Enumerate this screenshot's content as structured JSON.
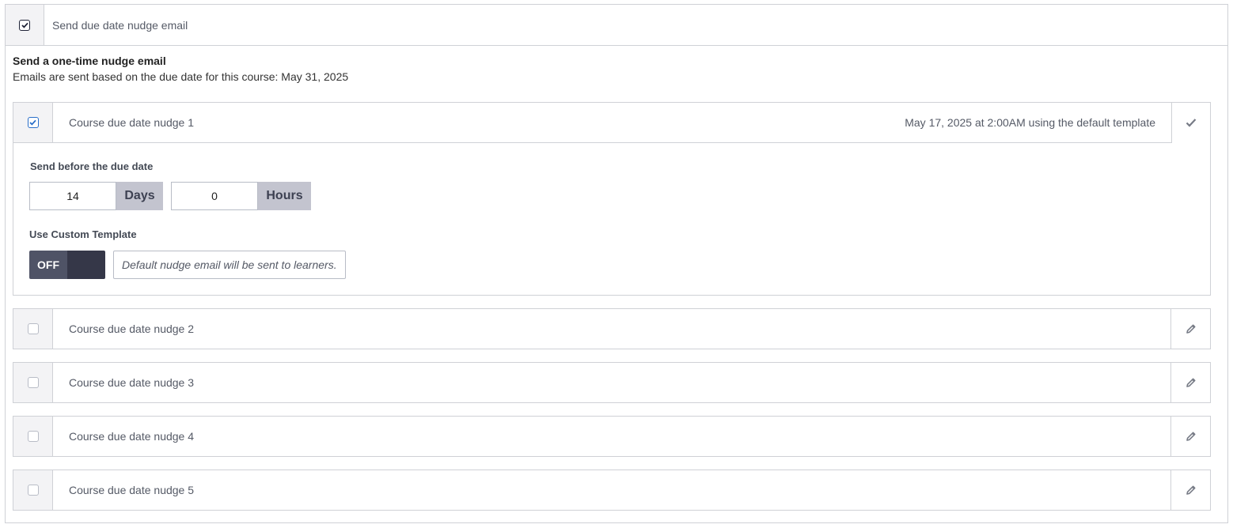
{
  "header": {
    "title": "Send due date nudge email",
    "checked": true
  },
  "intro": {
    "title": "Send a one-time nudge email",
    "description": "Emails are sent based on the due date for this course: May 31, 2025"
  },
  "nudges": [
    {
      "label": "Course due date nudge 1",
      "checked": true,
      "summary": "May 17, 2025 at 2:00AM using the default template",
      "action_icon": "checkmark-icon"
    },
    {
      "label": "Course due date nudge 2",
      "checked": false,
      "action_icon": "pencil-icon"
    },
    {
      "label": "Course due date nudge 3",
      "checked": false,
      "action_icon": "pencil-icon"
    },
    {
      "label": "Course due date nudge 4",
      "checked": false,
      "action_icon": "pencil-icon"
    },
    {
      "label": "Course due date nudge 5",
      "checked": false,
      "action_icon": "pencil-icon"
    }
  ],
  "send_before": {
    "label": "Send before the due date",
    "days_value": "14",
    "days_unit": "Days",
    "hours_value": "0",
    "hours_unit": "Hours"
  },
  "custom_template": {
    "label": "Use Custom Template",
    "toggle_state": "OFF",
    "note": "Default nudge email will be sent to learners."
  },
  "colors": {
    "toggle_bg": "#4f5366",
    "checkbox_blue": "#2a6fc9",
    "addon_bg": "#c3c4cf"
  }
}
